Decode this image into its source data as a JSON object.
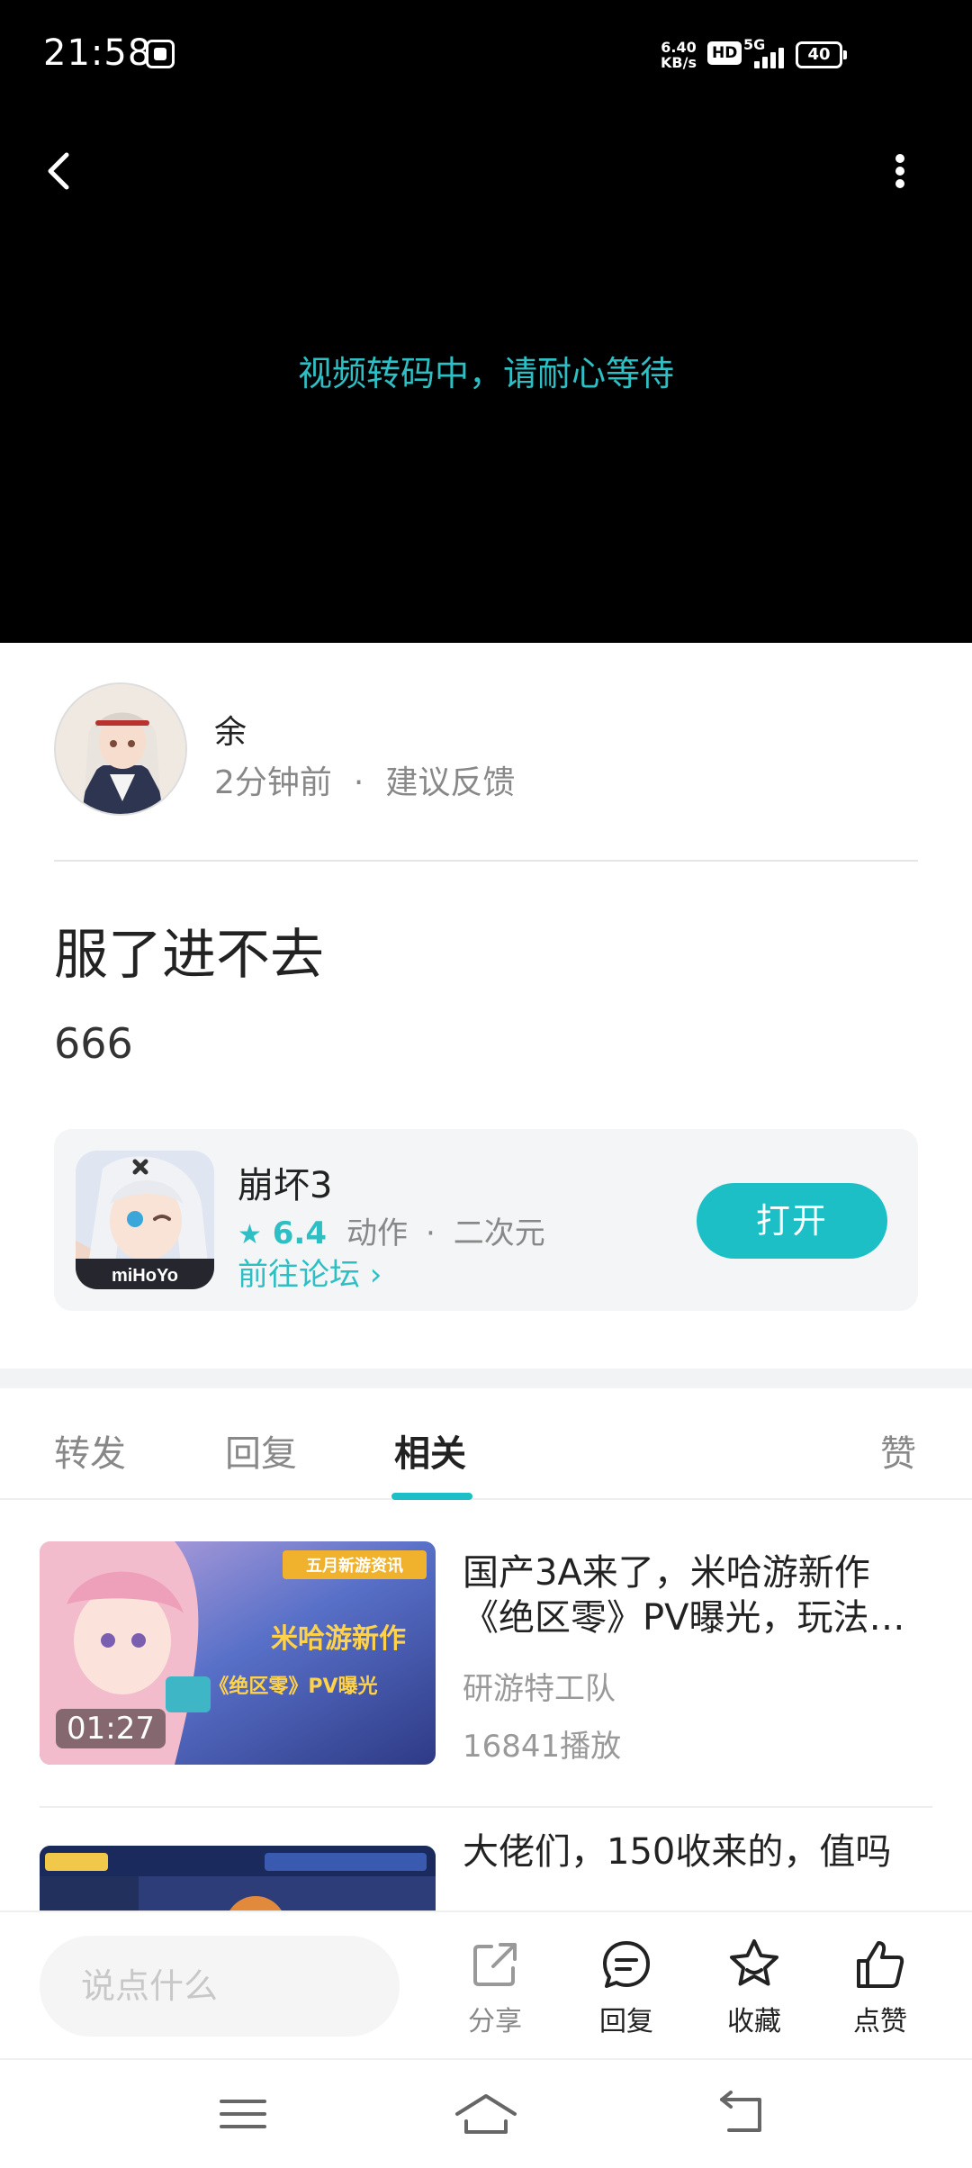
{
  "status_bar": {
    "time": "21:58",
    "net_speed_value": "6.40",
    "net_speed_unit": "KB/s",
    "hd": "HD",
    "network": "5G",
    "battery": "40"
  },
  "video": {
    "status_text": "视频转码中，请耐心等待"
  },
  "author": {
    "name": "余",
    "time": "2分钟前",
    "separator": "·",
    "feedback": "建议反馈"
  },
  "post": {
    "title": "服了进不去",
    "body": "666"
  },
  "game_card": {
    "name": "崩坏3",
    "rating": "6.4",
    "tag1": "动作",
    "separator": "·",
    "tag2": "二次元",
    "forum_link": "前往论坛 ›",
    "open_button": "打开",
    "icon_brand": "miHoYo"
  },
  "tabs": {
    "items": [
      "转发",
      "回复",
      "相关",
      "赞"
    ],
    "active": "相关"
  },
  "related": [
    {
      "title": "国产3A来了，米哈游新作《绝区零》PV曝光，玩法…",
      "author": "研游特工队",
      "plays": "16841播放",
      "duration": "01:27",
      "thumb_banner": "五月新游资讯",
      "thumb_headline": "米哈游新作",
      "thumb_sub": "《绝区零》PV曝光"
    },
    {
      "title": "大佬们，150收来的，值吗",
      "author": "",
      "plays": "",
      "duration": ""
    }
  ],
  "action_bar": {
    "input_placeholder": "说点什么",
    "share": "分享",
    "reply": "回复",
    "favorite": "收藏",
    "like": "点赞"
  },
  "colors": {
    "accent": "#1cbfc5",
    "video_bg": "#000000"
  }
}
